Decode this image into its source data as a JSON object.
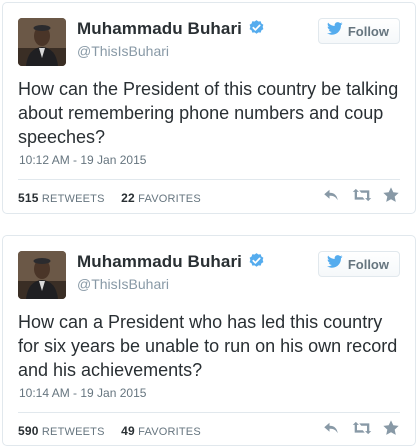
{
  "tweets": [
    {
      "author_name": "Muhammadu Buhari",
      "handle": "@ThisIsBuhari",
      "follow_label": "Follow",
      "text": "How can the President of this country be talking about remembering phone numbers and coup speeches?",
      "timestamp": "10:12 AM - 19 Jan 2015",
      "retweets_count": "515",
      "retweets_label": "RETWEETS",
      "favorites_count": "22",
      "favorites_label": "FAVORITES"
    },
    {
      "author_name": "Muhammadu Buhari",
      "handle": "@ThisIsBuhari",
      "follow_label": "Follow",
      "text": "How can a President who has led this country for six years be unable to run on his own record and his achievements?",
      "timestamp": "10:14 AM - 19 Jan 2015",
      "retweets_count": "590",
      "retweets_label": "RETWEETS",
      "favorites_count": "49",
      "favorites_label": "FAVORITES"
    }
  ],
  "colors": {
    "verified_blue": "#55acee",
    "icon_gray": "#8899a6",
    "border": "#e1e8ed"
  },
  "icons": [
    "verified-icon",
    "twitter-bird-icon",
    "reply-icon",
    "retweet-icon",
    "favorite-star-icon"
  ]
}
